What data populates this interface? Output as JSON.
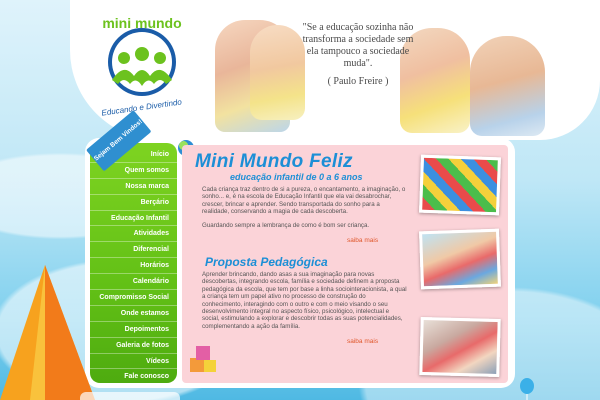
{
  "logo": {
    "title": "mini mundo",
    "slogan": "Educando e Divertindo"
  },
  "quote": {
    "text": "\"Se a educação sozinha não transforma a sociedade sem ela tampouco a sociedade muda\".",
    "author": "( Paulo Freire )"
  },
  "ribbon": "Sejam Bem Vindos!",
  "nav": {
    "items": [
      "Início",
      "Quem somos",
      "Nossa marca",
      "Berçário",
      "Educação Infantil",
      "Atividades",
      "Diferencial",
      "Horários",
      "Calendário",
      "Compromisso Social",
      "Onde estamos",
      "Depoimentos",
      "Galeria de fotos",
      "Vídeos",
      "Fale conosco"
    ]
  },
  "main": {
    "title": "Mini Mundo Feliz",
    "subtitle": "educação infantil de 0 a 6 anos",
    "paragraph1": "Cada criança traz dentro de si a pureza, o encantamento, a imaginação, o sonho... e, é na escola de Educação Infantil que ela vai desabrochar, crescer, brincar e aprender. Sendo transportada do sonho para a realidade, conservando a magia de cada descoberta.",
    "paragraph2": "Guardando sempre a lembrança de como é bom ser criança.",
    "more1": "saiba mais",
    "proposta_title": "Proposta Pedagógica",
    "paragraph3": "Aprender brincando, dando asas a sua imaginação para novas descobertas, integrando escola, família e sociedade definem a proposta pedagógica da escola, que tem por base a linha socio­interacionista, a qual a criança tem um papel ativo no processo de construção do conhecimento, interagindo com o outro e com o meio visando o seu desenvolvimento integral no aspecto físico, psicológico, intelectual e social, estimulando a explorar e descobrir todas as suas potencialidades, complementando a ação da família.",
    "more2": "saiba mais"
  },
  "colors": {
    "nav_green": "#62c016",
    "title_blue": "#1c8fd6",
    "link_orange": "#e0582c",
    "content_pink": "#fbd3d8"
  }
}
